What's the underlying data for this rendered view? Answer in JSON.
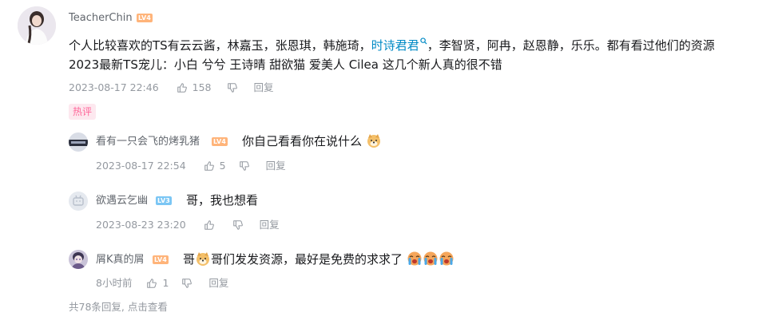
{
  "main_comment": {
    "username": "TeacherChin",
    "level": "LV4",
    "text_part1": "个人比较喜欢的TS有云云酱，林嘉玉，张恩琪，韩施琦，",
    "link_text": "时诗君君",
    "text_part2": "，李智贤，阿冉，赵恩静，乐乐。都有看过他们的资源",
    "text_line2": "2023最新TS宠儿：小白 兮兮 王诗晴 甜欲猫 爱美人 Cilea  这几个新人真的很不错",
    "date": "2023-08-17 22:46",
    "likes": "158",
    "reply_label": "回复"
  },
  "hot_tag": "热评",
  "replies": [
    {
      "username": "看有一只会飞的烤乳猪",
      "level": "LV4",
      "text": "你自己看看你在说什么",
      "date": "2023-08-17 22:54",
      "likes": "5",
      "reply_label": "回复"
    },
    {
      "username": "欲遇云乞幽",
      "level": "LV3",
      "text": "哥，我也想看",
      "date": "2023-08-23 23:20",
      "likes": "",
      "reply_label": "回复"
    },
    {
      "username": "屑K真的屑",
      "level": "LV4",
      "text_prefix": "哥",
      "text": "哥们发发资源，最好是免费的求求了",
      "date": "8小时前",
      "likes": "1",
      "reply_label": "回复"
    }
  ],
  "footer": {
    "text": "共78条回复, 点击查看"
  },
  "colors": {
    "link": "#008ac5",
    "meta": "#9499a0",
    "hot_tag_bg": "#fde8ef",
    "hot_tag_fg": "#ff6699",
    "level_orange": "#ffb47a",
    "level_blue": "#7bc6f4"
  },
  "icons": {
    "search": "search-icon",
    "like": "thumbs-up-icon",
    "dislike": "thumbs-down-icon"
  }
}
